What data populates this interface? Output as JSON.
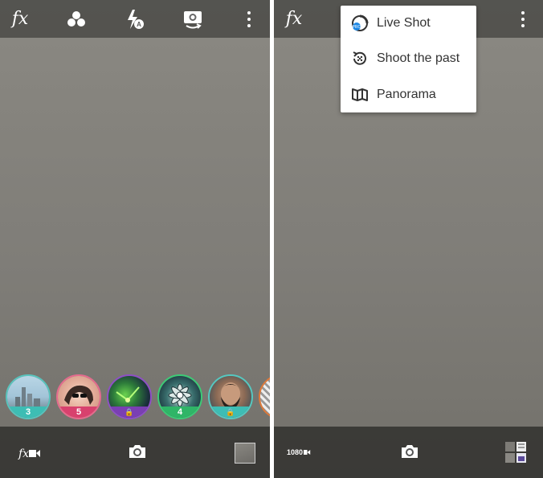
{
  "left_screen": {
    "filters": [
      {
        "badge": "3",
        "badge_color": "#3dbdb4",
        "ring": "#58c4bd"
      },
      {
        "badge": "5",
        "badge_color": "#d8416e",
        "ring": "#e56b8e"
      },
      {
        "badge": "🔒",
        "badge_color": "#7a3fb3",
        "ring": "#8e4fc6"
      },
      {
        "badge": "4",
        "badge_color": "#2fb567",
        "ring": "#3ccb76"
      },
      {
        "badge": "🔒",
        "badge_color": "#3dbdb4",
        "ring": "#55c8c0"
      }
    ]
  },
  "right_screen": {
    "video_resolution": "1080",
    "menu": [
      {
        "label": "Live Shot",
        "icon": "live-shot-icon"
      },
      {
        "label": "Shoot the past",
        "icon": "shoot-past-icon"
      },
      {
        "label": "Panorama",
        "icon": "panorama-icon"
      }
    ],
    "menu_icon_accent": "#1e88e5"
  },
  "icons": {
    "top_left": [
      "fx-icon",
      "color-filters-icon",
      "flash-auto-icon",
      "switch-camera-icon",
      "more-options-icon"
    ],
    "bottom_left": [
      "fx-video-icon",
      "camera-shutter-icon",
      "gallery-thumbnail"
    ],
    "top_right": [
      "fx-icon",
      "more-options-icon"
    ],
    "bottom_right": [
      "video-1080-icon",
      "camera-shutter-icon",
      "collage-icon"
    ]
  }
}
